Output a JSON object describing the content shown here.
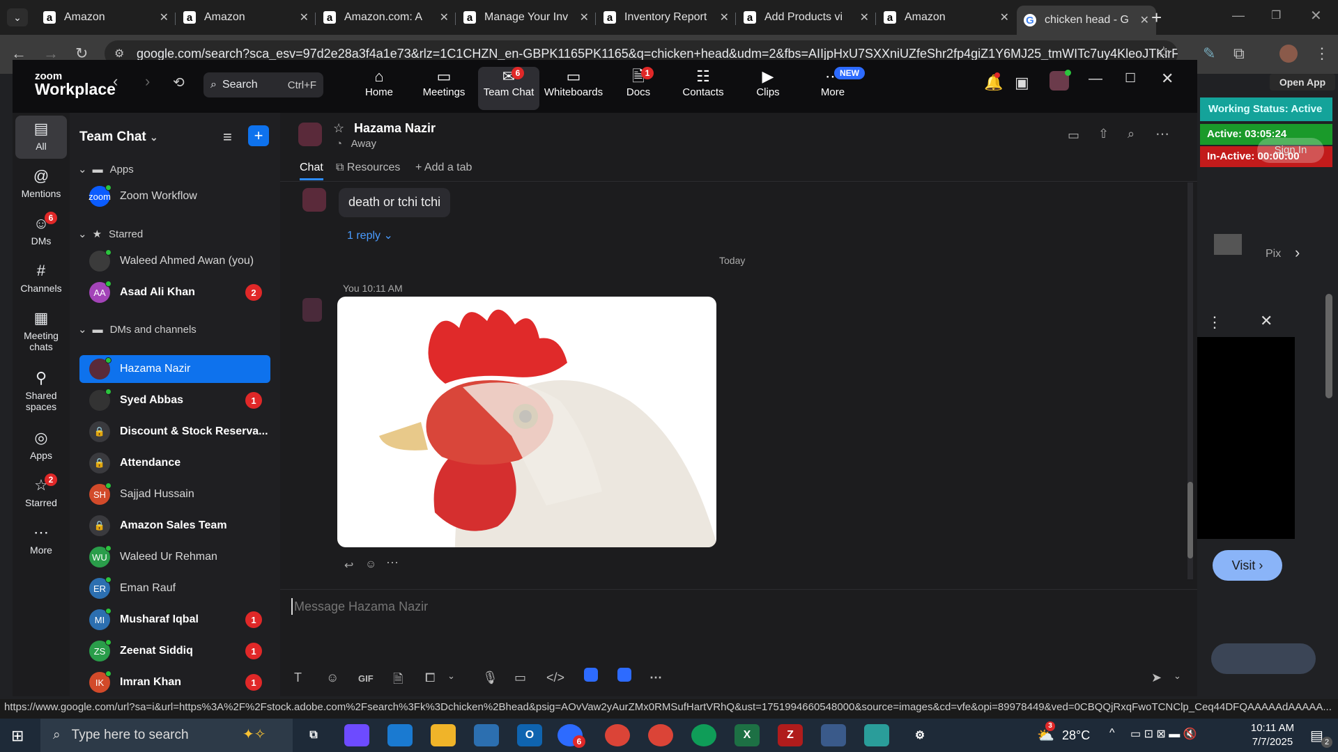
{
  "browser": {
    "tabs": [
      {
        "title": "Amazon",
        "icon": "amazon-icon"
      },
      {
        "title": "Amazon",
        "icon": "amazon-icon"
      },
      {
        "title": "Amazon.com: A",
        "icon": "amazon-icon"
      },
      {
        "title": "Manage Your Inv",
        "icon": "amazon-icon"
      },
      {
        "title": "Inventory Report",
        "icon": "amazon-icon"
      },
      {
        "title": "Add Products vi",
        "icon": "amazon-icon"
      },
      {
        "title": "Amazon",
        "icon": "amazon-icon"
      },
      {
        "title": "chicken head - G",
        "icon": "google-icon",
        "active": true
      }
    ],
    "url": "google.com/search?sca_esv=97d2e28a3f4a1e73&rlz=1C1CHZN_en-GBPK1165PK1165&q=chicken+head&udm=2&fbs=AIIjpHxU7SXXniUZfeShr2fp4giZ1Y6MJ25_tmWITc7uy4KleoJTKirFiV...",
    "status_url": "https://www.google.com/url?sa=i&url=https%3A%2F%2Fstock.adobe.com%2Fsearch%3Fk%3Dchicken%2Bhead&psig=AOvVaw2yAurZMx0RMSufHartVRhQ&ust=1751994660548000&source=images&cd=vfe&opi=89978449&ved=0CBQQjRxqFwoTCNClp_Ceq44DFQAAAAAdAAAAA..."
  },
  "zoom": {
    "logo_top": "zoom",
    "logo_bottom": "Workplace",
    "search_label": "Search",
    "search_shortcut": "Ctrl+F",
    "nav": [
      {
        "label": "Home",
        "icon": "home-icon"
      },
      {
        "label": "Meetings",
        "icon": "video-icon"
      },
      {
        "label": "Team Chat",
        "icon": "chat-icon",
        "badge": "6",
        "active": true
      },
      {
        "label": "Whiteboards",
        "icon": "whiteboard-icon"
      },
      {
        "label": "Docs",
        "icon": "docs-icon",
        "badge": "1"
      },
      {
        "label": "Contacts",
        "icon": "contacts-icon"
      },
      {
        "label": "Clips",
        "icon": "clips-icon"
      },
      {
        "label": "More",
        "icon": "more-icon",
        "tag": "NEW"
      }
    ],
    "rail": [
      {
        "label": "All",
        "icon": "chat-bubble-icon",
        "active": true
      },
      {
        "label": "Mentions",
        "icon": "at-icon"
      },
      {
        "label": "DMs",
        "icon": "people-icon",
        "badge": "6"
      },
      {
        "label": "Channels",
        "icon": "hash-icon"
      },
      {
        "label": "Meeting chats",
        "icon": "calendar-icon"
      },
      {
        "label": "Shared spaces",
        "icon": "share-icon"
      },
      {
        "label": "Apps",
        "icon": "apps-icon"
      },
      {
        "label": "Starred",
        "icon": "star-icon",
        "badge": "2"
      },
      {
        "label": "More",
        "icon": "more-icon"
      }
    ],
    "sidebar": {
      "title": "Team Chat",
      "sections": {
        "apps": "Apps",
        "starred": "Starred",
        "dms": "DMs and channels"
      },
      "apps": [
        {
          "name": "Zoom Workflow"
        }
      ],
      "starred": [
        {
          "name": "Waleed Ahmed Awan (you)",
          "initials": "",
          "color": "#3b3b3b"
        },
        {
          "name": "Asad Ali Khan",
          "initials": "AA",
          "color": "#a344b8",
          "count": "2",
          "bold": true
        }
      ],
      "dms": [
        {
          "name": "Hazama Nazir",
          "initials": "",
          "color": "#5a2a3a",
          "selected": true
        },
        {
          "name": "Syed Abbas",
          "initials": "",
          "color": "#333",
          "count": "1",
          "bold": true
        },
        {
          "name": "Discount & Stock Reserva...",
          "initials": "",
          "color": "#3a3a3e",
          "lock": true,
          "bold": true
        },
        {
          "name": "Attendance",
          "initials": "",
          "color": "#3a3a3e",
          "lock": true,
          "bold": true
        },
        {
          "name": "Sajjad Hussain",
          "initials": "SH",
          "color": "#d24a2a"
        },
        {
          "name": "Amazon Sales Team",
          "initials": "",
          "color": "#3a3a3e",
          "lock": true,
          "bold": true
        },
        {
          "name": "Waleed Ur Rehman",
          "initials": "WU",
          "color": "#2a9d4a"
        },
        {
          "name": "Eman Rauf",
          "initials": "ER",
          "color": "#2c6fb0"
        },
        {
          "name": "Musharaf Iqbal",
          "initials": "MI",
          "color": "#2c6fb0",
          "count": "1",
          "bold": true
        },
        {
          "name": "Zeenat Siddiq",
          "initials": "ZS",
          "color": "#2a9d4a",
          "count": "1",
          "bold": true
        },
        {
          "name": "Imran Khan",
          "initials": "IK",
          "color": "#d24a2a",
          "count": "1",
          "bold": true
        }
      ]
    },
    "chat": {
      "contact_name": "Hazama Nazir",
      "contact_status": "Away",
      "tabs": [
        "Chat",
        "Resources",
        "Add a tab"
      ],
      "prev_message": "death or tchi tchi",
      "reply_label": "1 reply",
      "day_divider": "Today",
      "sender_line": "You 10:11 AM",
      "composer_placeholder": "Message Hazama Nazir",
      "toolbar": [
        "format-icon",
        "emoji-icon",
        "GIF",
        "file-icon",
        "screenshot-icon",
        "mic-icon",
        "video-msg-icon",
        "code-icon",
        "app1-icon",
        "app2-icon",
        "more-icon"
      ],
      "gif_label": "GIF"
    }
  },
  "right_panel": {
    "open_app": "Open App",
    "working_status": "Working Status: Active",
    "active_time": "Active: 03:05:24",
    "inactive_time": "In-Active: 00:00:00",
    "sign_in": "Sign In",
    "pix": "Pix",
    "visit": "Visit"
  },
  "taskbar": {
    "search_placeholder": "Type here to search",
    "weather": "28°C",
    "time": "10:11 AM",
    "date": "7/7/2025",
    "notif_count": "2",
    "zoom_badge": "6",
    "weather_badge": "3"
  }
}
